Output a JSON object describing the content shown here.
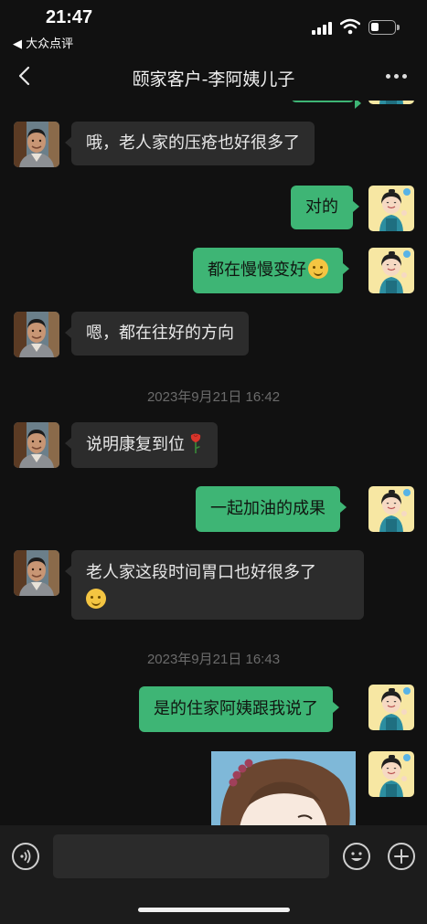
{
  "status_bar": {
    "time": "21:47",
    "back_app": "◀ 大众点评",
    "battery_level": 0.35,
    "icons": [
      "signal-icon",
      "wifi-icon",
      "battery-icon"
    ]
  },
  "nav": {
    "title": "颐家客户-李阿姨儿子",
    "back_icon": "chevron-left-icon",
    "more_icon": "more-dots-icon"
  },
  "messages": [
    {
      "side": "in",
      "text": "哦，老人家的压疮也好很多了"
    },
    {
      "side": "out",
      "text": "对的"
    },
    {
      "side": "out",
      "text": "都在慢慢变好",
      "emoji": "smile-emoji"
    },
    {
      "side": "in",
      "text": "嗯，都在往好的方向"
    },
    {
      "type": "timestamp",
      "text": "2023年9月21日 16:42"
    },
    {
      "side": "in",
      "text": "说明康复到位",
      "emoji": "rose-emoji"
    },
    {
      "side": "out",
      "text": "一起加油的成果"
    },
    {
      "side": "in",
      "text": "老人家这段时间胃口也好很多了",
      "emoji": "thinking-emoji"
    },
    {
      "type": "timestamp",
      "text": "2023年9月21日 16:43"
    },
    {
      "side": "out",
      "text": "是的住家阿姨跟我说了"
    },
    {
      "side": "out",
      "type": "image",
      "description_icon": "cartoon-girl-image"
    }
  ],
  "input_bar": {
    "value": "",
    "voice_icon": "voice-icon",
    "emoji_icon": "emoji-icon",
    "plus_icon": "plus-icon"
  },
  "colors": {
    "background": "#111111",
    "bubble_incoming": "#2c2c2c",
    "bubble_outgoing": "#3eb575",
    "timestamp": "#6b6b6b"
  }
}
